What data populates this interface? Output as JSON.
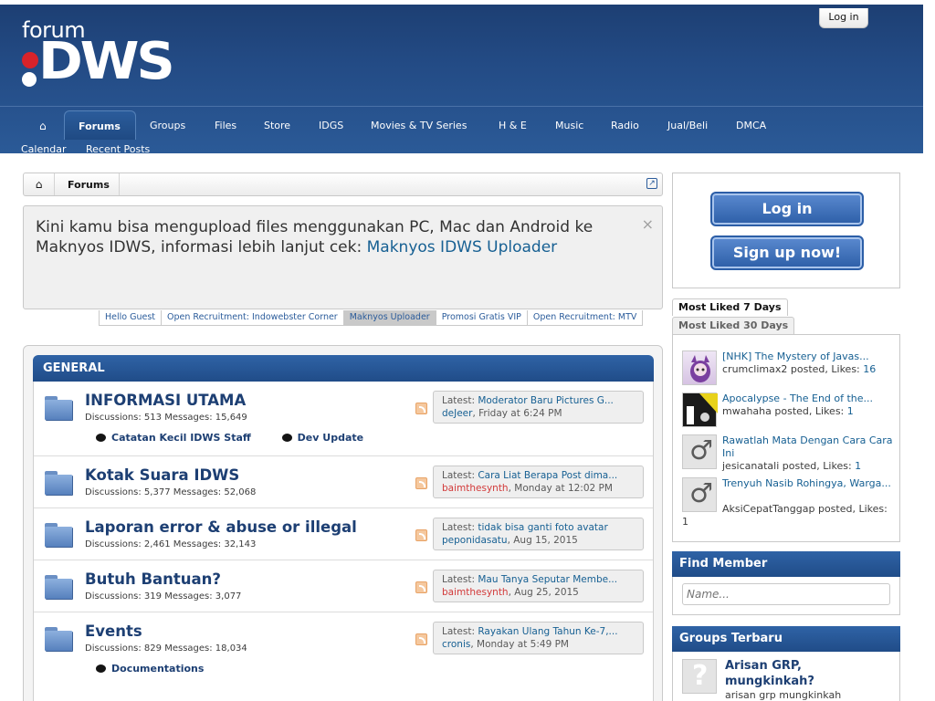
{
  "header": {
    "logo_forum": "forum",
    "logo_brand": "DWS",
    "login_tab": "Log in"
  },
  "nav": {
    "tabs": [
      {
        "label": "Forums",
        "active": true
      },
      {
        "label": "Groups"
      },
      {
        "label": "Files"
      },
      {
        "label": "Store"
      },
      {
        "label": "IDGS"
      },
      {
        "label": "Movies & TV Series"
      },
      {
        "label": "H & E"
      },
      {
        "label": "Music"
      },
      {
        "label": "Radio"
      },
      {
        "label": "Jual/Beli"
      },
      {
        "label": "DMCA"
      }
    ],
    "subnav": [
      "Calendar",
      "Recent Posts"
    ]
  },
  "breadcrumb": {
    "items": [
      "Forums"
    ]
  },
  "notice": {
    "text": "Kini kamu bisa mengupload files menggunakan PC, Mac dan Android ke Maknyos IDWS, informasi lebih lanjut cek: ",
    "link": "Maknyos IDWS Uploader",
    "close": "×",
    "tabs": [
      {
        "label": "Hello Guest"
      },
      {
        "label": "Open Recruitment: Indowebster Corner"
      },
      {
        "label": "Maknyos Uploader",
        "active": true
      },
      {
        "label": "Promosi Gratis VIP"
      },
      {
        "label": "Open Recruitment: MTV"
      }
    ]
  },
  "category": {
    "title": "GENERAL",
    "forums": [
      {
        "title": "INFORMASI UTAMA",
        "stats": "Discussions: 513 Messages: 15,649",
        "latest_label": "Latest: ",
        "latest_title": "Moderator Baru Pictures G...",
        "latest_user": "deJeer",
        "latest_time": ", Friday at 6:24 PM",
        "subforums": [
          "Catatan Kecil IDWS Staff",
          "Dev Update"
        ]
      },
      {
        "title": "Kotak Suara IDWS",
        "stats": "Discussions: 5,377 Messages: 52,068",
        "latest_label": "Latest: ",
        "latest_title": "Cara Liat Berapa Post dima...",
        "latest_user": "baimthesynth",
        "latest_time": ", Monday at 12:02 PM"
      },
      {
        "title": "Laporan error & abuse or illegal",
        "stats": "Discussions: 2,461 Messages: 32,143",
        "latest_label": "Latest: ",
        "latest_title": "tidak bisa ganti foto avatar",
        "latest_user": "peponidasatu",
        "latest_time": ", Aug 15, 2015"
      },
      {
        "title": "Butuh Bantuan?",
        "stats": "Discussions: 319 Messages: 3,077",
        "latest_label": "Latest: ",
        "latest_title": "Mau Tanya Seputar Membe...",
        "latest_user": "baimthesynth",
        "latest_time": ", Aug 25, 2015"
      },
      {
        "title": "Events",
        "stats": "Discussions: 829 Messages: 18,034",
        "latest_label": "Latest: ",
        "latest_title": "Rayakan Ulang Tahun Ke-7,...",
        "latest_user": "cronis",
        "latest_time": ", Monday at 5:49 PM",
        "subforums": [
          "Documentations"
        ]
      }
    ]
  },
  "sidebar": {
    "login_button": "Log in",
    "signup_button": "Sign up now!",
    "liked_tabs": [
      "Most Liked 7 Days",
      "Most Liked 30 Days"
    ],
    "liked": [
      {
        "title": "[NHK] The Mystery of Javas...",
        "user": "crumclimax2",
        "posted": " posted, Likes: ",
        "likes": "16"
      },
      {
        "title": "Apocalypse - The End of the...",
        "user": "mwahaha",
        "posted": " posted, Likes: ",
        "likes": "1"
      },
      {
        "title": "Rawatlah Mata Dengan Cara Cara Ini",
        "user": "jesicanatali",
        "posted": " posted, Likes: ",
        "likes": "1"
      },
      {
        "title": "Trenyuh Nasib Rohingya, Warga...",
        "user": "AksiCepatTanggap",
        "posted": " posted, Likes: ",
        "likes": "1"
      }
    ],
    "find_member": {
      "title": "Find Member",
      "placeholder": "Name..."
    },
    "groups": {
      "title": "Groups Terbaru",
      "item_title": "Arisan GRP, mungkinkah?",
      "item_desc": "arisan grp mungkinkah"
    }
  },
  "colors": {
    "header_blue": "#234b85",
    "link_blue": "#176093",
    "red_user": "#d23a3a"
  }
}
